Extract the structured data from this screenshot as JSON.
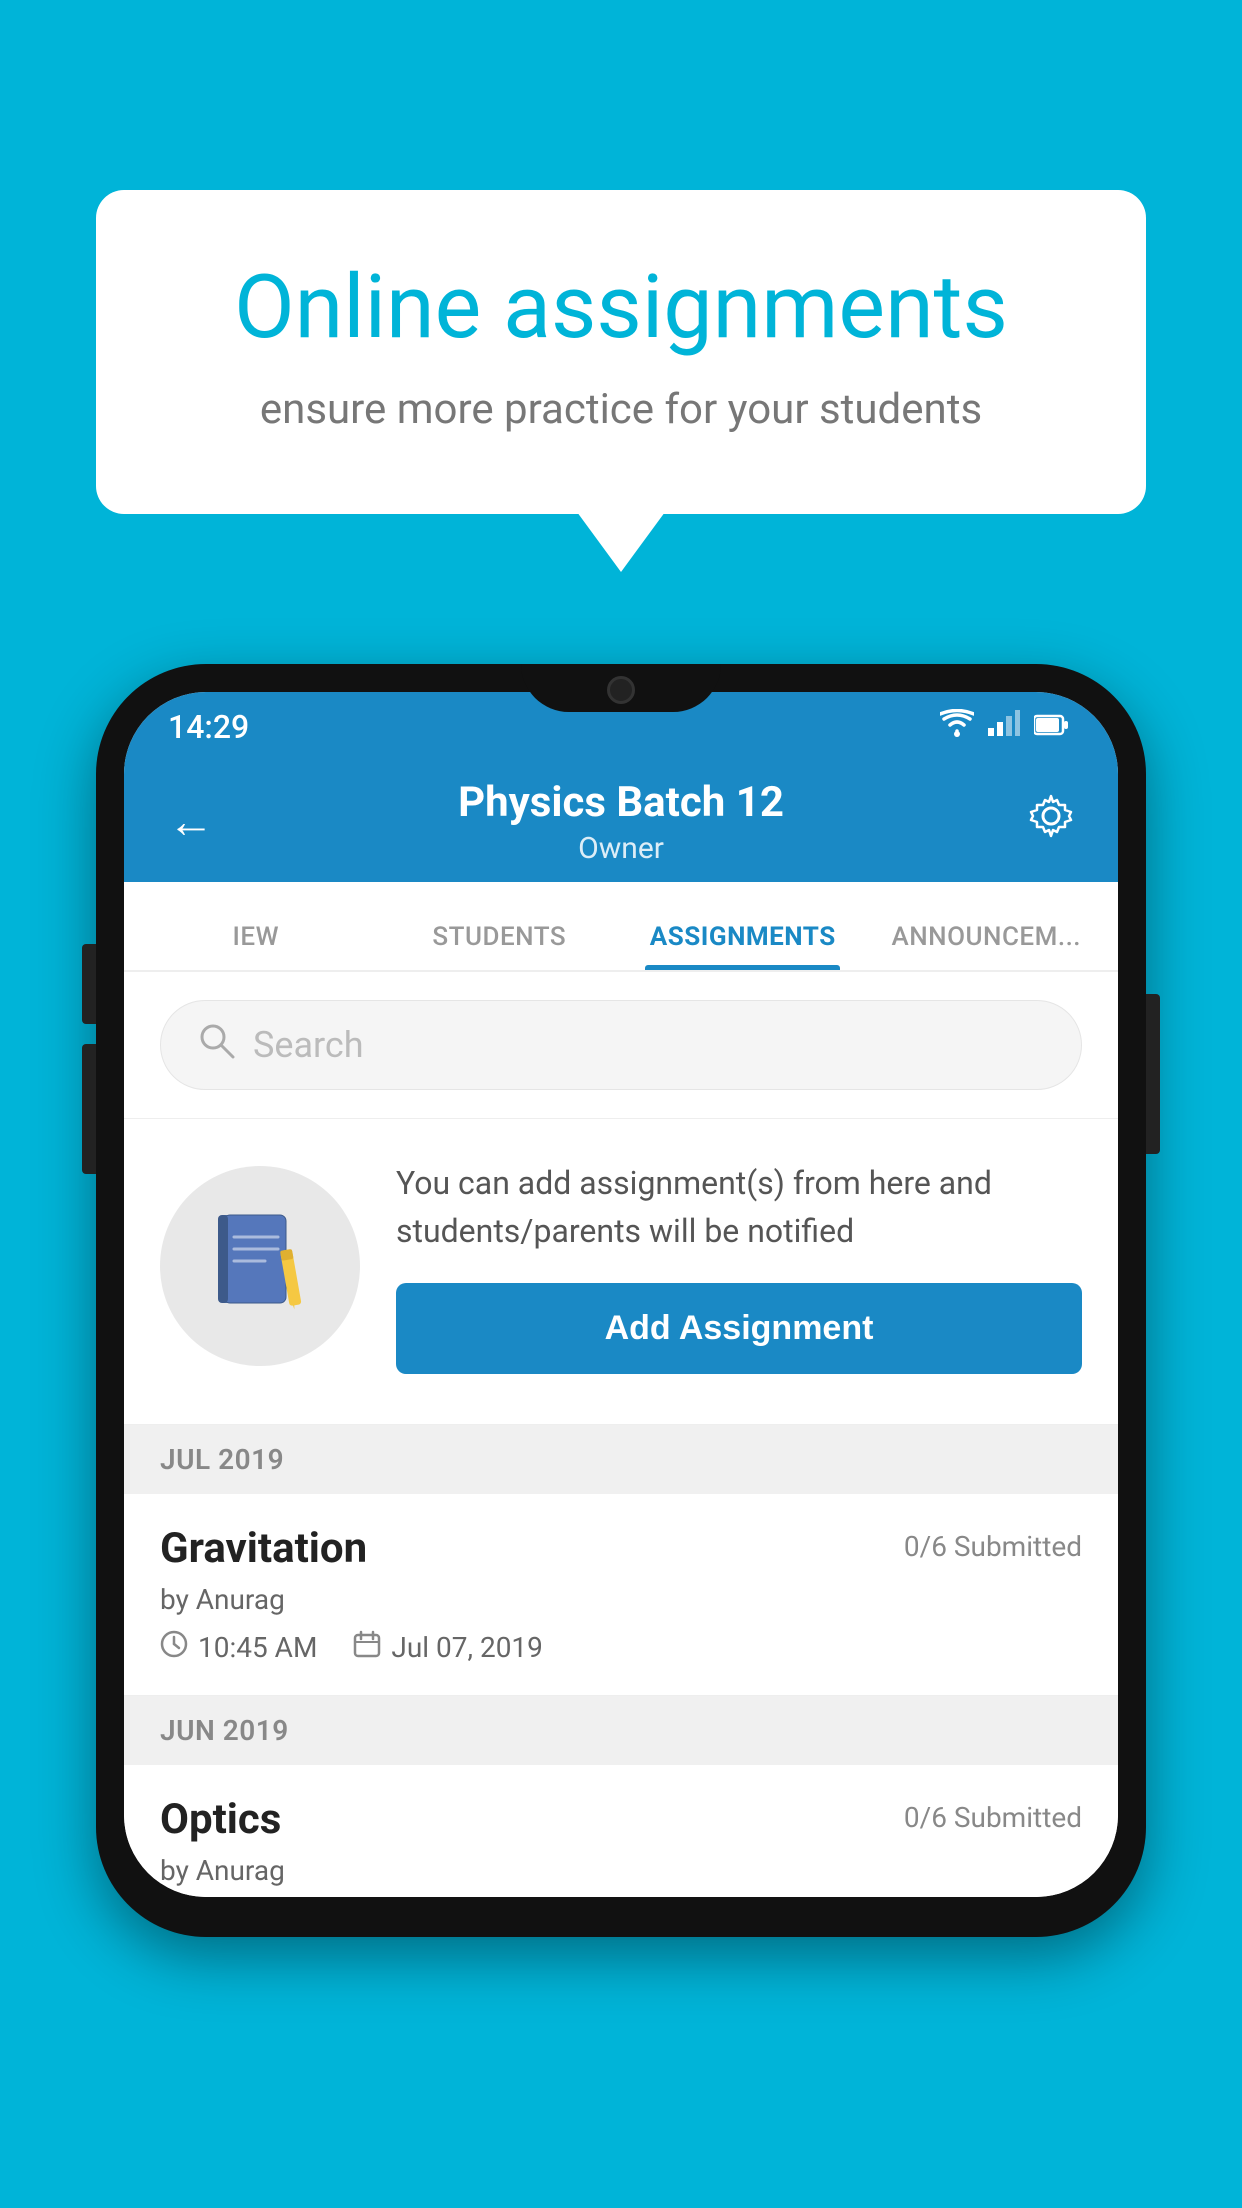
{
  "promo": {
    "title": "Online assignments",
    "subtitle": "ensure more practice for your students"
  },
  "status_bar": {
    "time": "14:29",
    "wifi": "▾",
    "signal": "▴▴",
    "battery": "▮"
  },
  "header": {
    "title": "Physics Batch 12",
    "subtitle": "Owner",
    "back_label": "←",
    "gear_label": "⚙"
  },
  "tabs": [
    {
      "label": "IEW",
      "active": false
    },
    {
      "label": "STUDENTS",
      "active": false
    },
    {
      "label": "ASSIGNMENTS",
      "active": true
    },
    {
      "label": "ANNOUNCEM...",
      "active": false
    }
  ],
  "search": {
    "placeholder": "Search"
  },
  "assignment_promo": {
    "description": "You can add assignment(s) from here and students/parents will be notified",
    "button_label": "Add Assignment"
  },
  "sections": [
    {
      "label": "JUL 2019",
      "assignments": [
        {
          "name": "Gravitation",
          "submitted": "0/6 Submitted",
          "by": "by Anurag",
          "time": "10:45 AM",
          "date": "Jul 07, 2019"
        }
      ]
    },
    {
      "label": "JUN 2019",
      "assignments": [
        {
          "name": "Optics",
          "submitted": "0/6 Submitted",
          "by": "by Anurag",
          "time": "",
          "date": ""
        }
      ]
    }
  ]
}
